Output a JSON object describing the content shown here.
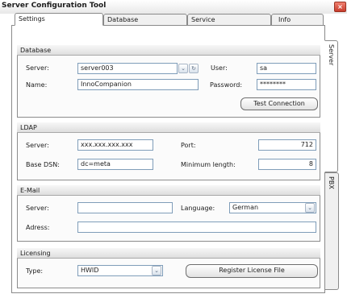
{
  "window": {
    "title": "Server Configuration Tool",
    "close_glyph": "×"
  },
  "tabs": [
    {
      "label": "Settings"
    },
    {
      "label": "Database"
    },
    {
      "label": "Service"
    },
    {
      "label": "Info"
    }
  ],
  "side_tabs": [
    {
      "label": "Server"
    },
    {
      "label": "PBX"
    }
  ],
  "database": {
    "group_label": "Database",
    "server_label": "Server:",
    "server_value": "server003",
    "user_label": "User:",
    "user_value": "sa",
    "name_label": "Name:",
    "name_value": "InnoCompanion",
    "password_label": "Password:",
    "password_value": "********",
    "test_button": "Test Connection",
    "dropdown_glyph": "⌄",
    "refresh_glyph": "↻"
  },
  "ldap": {
    "group_label": "LDAP",
    "server_label": "Server:",
    "server_value": "xxx.xxx.xxx.xxx",
    "port_label": "Port:",
    "port_value": "712",
    "basedn_label": "Base DSN:",
    "basedn_value": "dc=meta",
    "minlen_label": "Minimum length:",
    "minlen_value": "8"
  },
  "email": {
    "group_label": "E-Mail",
    "server_label": "Server:",
    "server_value": "",
    "language_label": "Language:",
    "language_value": "German",
    "address_label": "Adress:",
    "address_value": "",
    "dropdown_glyph": "⌄"
  },
  "licensing": {
    "group_label": "Licensing",
    "type_label": "Type:",
    "type_value": "HWID",
    "register_button": "Register License File",
    "dropdown_glyph": "⌄"
  }
}
